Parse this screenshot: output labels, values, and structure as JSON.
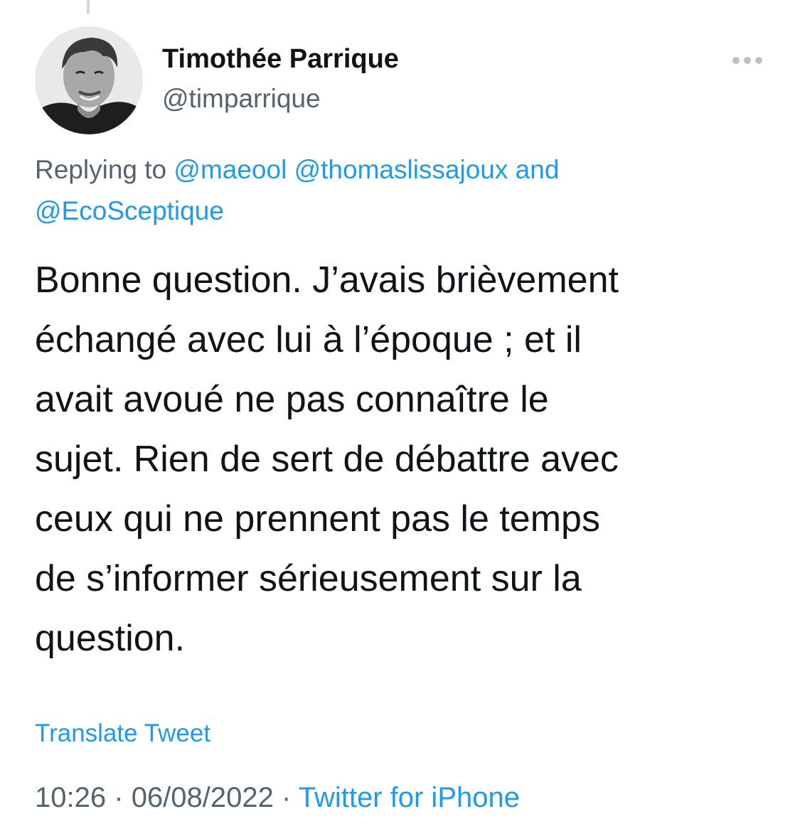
{
  "tweet": {
    "author": {
      "display_name": "Timothée Parrique",
      "handle": "@timparrique"
    },
    "more_icon": "more-horizontal-icon",
    "reply": {
      "prefix": "Replying to",
      "mentions": [
        "@maeool",
        "@thomaslissajoux"
      ],
      "conjunction": "and",
      "last_mention": "@EcoSceptique"
    },
    "text_lines": [
      "Bonne question. J’avais brièvement",
      "échangé avec lui à l’époque ; et il",
      "avait avoué ne pas connaître le",
      "sujet. Rien de sert de débattre avec",
      "ceux qui ne prennent pas le temps",
      "de s’informer sérieusement sur la",
      "question."
    ],
    "translate_label": "Translate Tweet",
    "time": "10:26",
    "date": "06/08/2022",
    "separator": "·",
    "source": "Twitter for iPhone"
  },
  "colors": {
    "link": "#1d9bf0",
    "secondary_text": "#536471",
    "primary_text": "#0f1419"
  }
}
